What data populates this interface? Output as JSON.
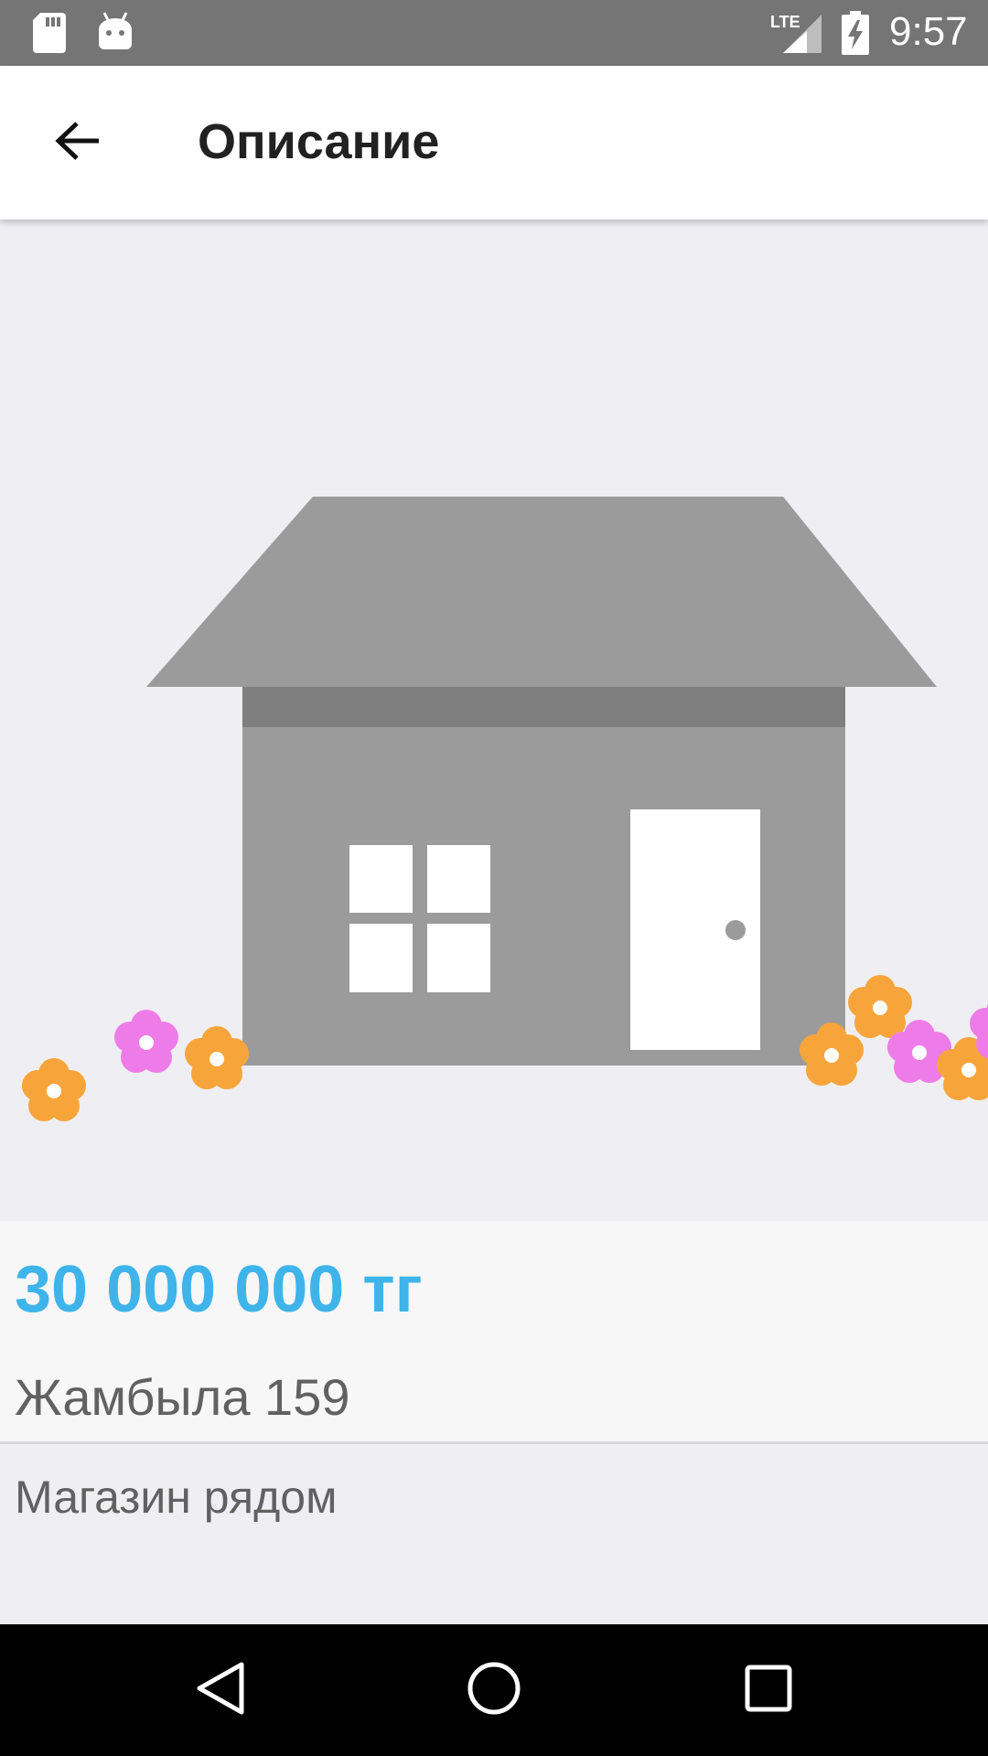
{
  "status_bar": {
    "time": "9:57",
    "network": "LTE",
    "icons": [
      "sd-card-icon",
      "android-debug-icon",
      "lte-signal-icon",
      "battery-charging-icon"
    ]
  },
  "app_bar": {
    "title": "Описание",
    "back_icon": "arrow-back-icon"
  },
  "hero": {
    "illustration": "house-placeholder-illustration",
    "colors": {
      "roof": "#9b9b9b",
      "wall": "#9b9b9b",
      "eave": "#7f7f7f",
      "window": "#ffffff",
      "door": "#ffffff",
      "flower_orange": "#f7a53a",
      "flower_pink": "#ee7ce8"
    }
  },
  "listing": {
    "price": "30 000 000 тг",
    "address": "Жамбыла 159",
    "description": "Магазин рядом"
  },
  "colors": {
    "accent": "#3fb4ea",
    "status_bar": "#757575",
    "background": "#efeef3"
  },
  "nav_bar": {
    "icons": [
      "nav-back-icon",
      "nav-home-icon",
      "nav-recents-icon"
    ]
  }
}
